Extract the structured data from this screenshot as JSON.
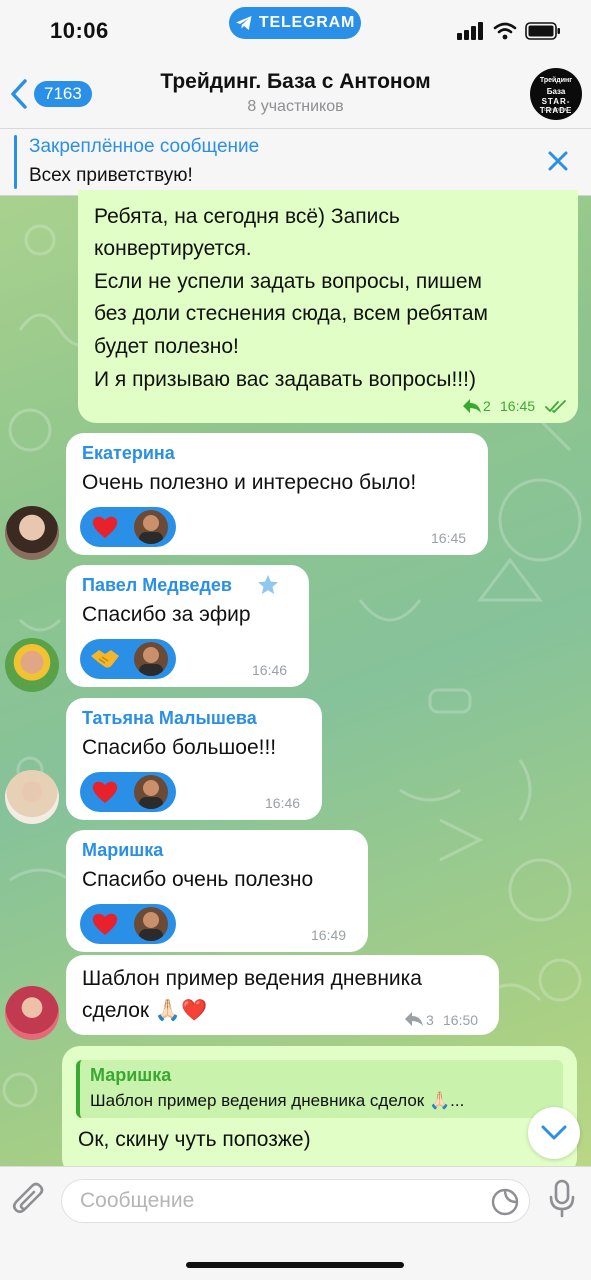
{
  "status_bar": {
    "time": "10:06",
    "app_badge": "TELEGRAM"
  },
  "nav": {
    "back_count": "7163",
    "title": "Трейдинг. База с Антоном",
    "subtitle": "8 участников",
    "avatar_text": {
      "line1": "Трейдинг",
      "line2": "База",
      "line3": "STAR-TRADE",
      "line4": "с Антоном"
    }
  },
  "pinned": {
    "label": "Закреплённое сообщение",
    "text": "Всех приветствую!"
  },
  "messages": [
    {
      "type": "outgoing",
      "lines": [
        "Ребята, на сегодня всё) Запись",
        "конвертируется.",
        "Если не успели задать вопросы, пишем",
        "без доли стеснения сюда, всем ребятам",
        "будет полезно!",
        "И я призываю вас задавать вопросы!!!)"
      ],
      "replies": "2",
      "time": "16:45"
    },
    {
      "type": "incoming",
      "sender": "Екатерина",
      "text": "Очень полезно и интересно было!",
      "reaction": "heart",
      "time": "16:45"
    },
    {
      "type": "incoming",
      "sender": "Павел Медведев",
      "text": "Спасибо за эфир",
      "reaction": "handshake",
      "time": "16:46"
    },
    {
      "type": "incoming",
      "sender": "Татьяна Малышева",
      "text": "Спасибо большое!!!",
      "reaction": "heart",
      "time": "16:46"
    },
    {
      "type": "incoming",
      "sender": "Маришка",
      "text": "Спасибо очень полезно",
      "reaction": "heart",
      "time": "16:49"
    },
    {
      "type": "incoming",
      "sender": "",
      "lines": [
        "Шаблон пример ведения дневника",
        "сделок 🙏🏻❤️"
      ],
      "replies": "3",
      "time": "16:50"
    },
    {
      "type": "outgoing",
      "quote_name": "Маришка",
      "quote_text": "Шаблон пример ведения дневника сделок 🙏🏻...",
      "text": "Ок, скину чуть попозже)"
    }
  ],
  "input": {
    "placeholder": "Сообщение"
  },
  "colors": {
    "accent": "#2a8fe6",
    "outgoing_bubble": "#e1fec6",
    "name_ekaterina": "#2a8fe6",
    "name_pavel": "#2a8fe6",
    "name_tatiana": "#2a8fe6",
    "name_marishka": "#2a8fe6",
    "quote_name": "#3aa932"
  }
}
